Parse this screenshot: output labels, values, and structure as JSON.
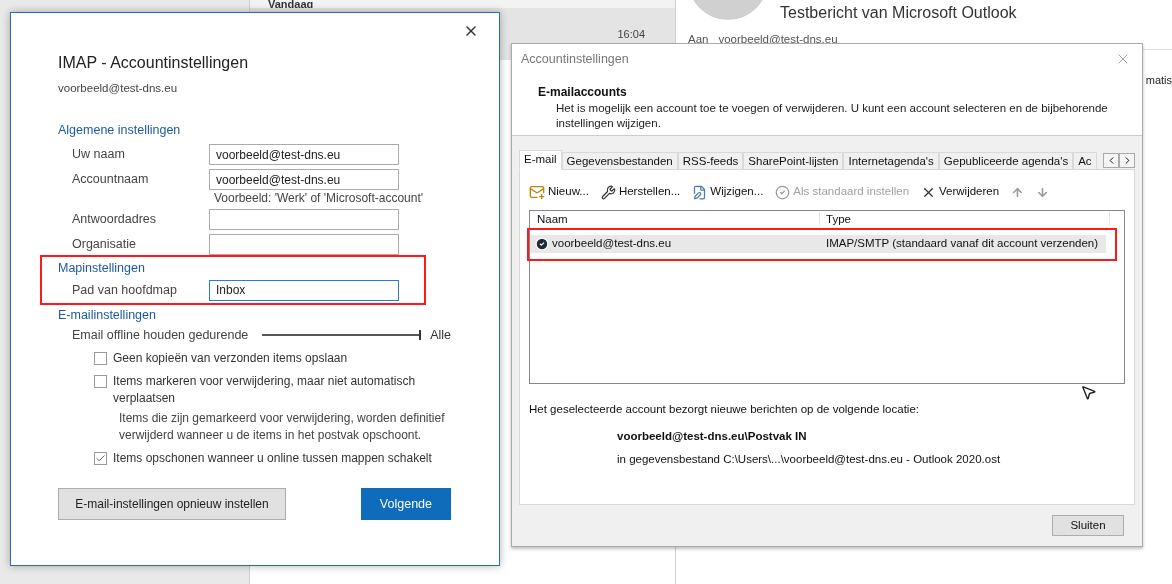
{
  "outlook": {
    "group_header": "Vandaag",
    "time": "16:04",
    "subject": "Testbericht van Microsoft Outlook",
    "to_label": "Aan",
    "to_value": "voorbeeld@test-dns.eu",
    "body_fragment": "matis"
  },
  "imap_dialog": {
    "title": "IMAP - Accountinstellingen",
    "account": "voorbeeld@test-dns.eu",
    "general_heading": "Algemene instellingen",
    "fields": [
      {
        "label": "Uw naam",
        "value": "voorbeeld@test-dns.eu",
        "focused": false
      },
      {
        "label": "Accountnaam",
        "value": "voorbeeld@test-dns.eu",
        "hint": "Voorbeeld: 'Werk' of 'Microsoft-account'",
        "focused": false
      },
      {
        "label": "Antwoordadres",
        "focused": false
      },
      {
        "label": "Organisatie",
        "focused": false
      }
    ],
    "folder_heading": "Mapinstellingen",
    "folder_field": {
      "label": "Pad van hoofdmap",
      "value": "Inbox",
      "focused": true
    },
    "mail_heading": "E-mailinstellingen",
    "slider": {
      "label": "Email offline houden gedurende",
      "level": 1,
      "reading": "Alle"
    },
    "checkboxes": [
      {
        "label": "Geen kopieën van verzonden items opslaan",
        "checked": false
      },
      {
        "label": "Items markeren voor verwijdering, maar niet automatisch verplaatsen",
        "checked": false,
        "note": "Items die zijn gemarkeerd voor verwijdering, worden definitief verwijderd wanneer u de items in het postvak opschoont."
      },
      {
        "label": "Items opschonen wanneer u online tussen mappen schakelt",
        "checked": true
      }
    ],
    "buttons": [
      {
        "label": "E-mail-instellingen opnieuw instellen",
        "kind": "secondary"
      },
      {
        "label": "Volgende",
        "kind": "primary"
      }
    ]
  },
  "account_dialog": {
    "title": "Accountinstellingen",
    "heading": "E-mailaccounts",
    "description": "Het is mogelijk een account toe te voegen of verwijderen. U kunt een account selecteren en de bijbehorende instellingen wijzigen.",
    "tabs": [
      {
        "label": "E-mail",
        "selected": true
      },
      {
        "label": "Gegevensbestanden",
        "selected": false
      },
      {
        "label": "RSS-feeds",
        "selected": false
      },
      {
        "label": "SharePoint-lijsten",
        "selected": false
      },
      {
        "label": "Internetagenda's",
        "selected": false
      },
      {
        "label": "Gepubliceerde agenda's",
        "selected": false
      },
      {
        "label": "Ac",
        "selected": false
      }
    ],
    "toolbar": [
      {
        "kind": "new",
        "label": "Nieuw...",
        "disabled": false
      },
      {
        "kind": "repair",
        "label": "Herstellen...",
        "disabled": false
      },
      {
        "kind": "change",
        "label": "Wijzigen...",
        "disabled": false
      },
      {
        "kind": "default",
        "label": "Als standaard instellen",
        "disabled": true
      },
      {
        "kind": "remove",
        "label": "Verwijderen",
        "disabled": false
      },
      {
        "kind": "up",
        "disabled": true
      },
      {
        "kind": "down",
        "disabled": true
      }
    ],
    "columns": [
      "Naam",
      "Type"
    ],
    "rows": [
      {
        "name": "voorbeeld@test-dns.eu",
        "type": "IMAP/SMTP (standaard vanaf dit account verzenden)",
        "selected": true
      }
    ],
    "location_intro": "Het geselecteerde account bezorgt nieuwe berichten op de volgende locatie:",
    "location_path": "voorbeeld@test-dns.eu\\Postvak IN",
    "location_file": "in gegevensbestand C:\\Users\\...\\voorbeeld@test-dns.eu - Outlook 2020.ost",
    "close_button": "Sluiten"
  }
}
